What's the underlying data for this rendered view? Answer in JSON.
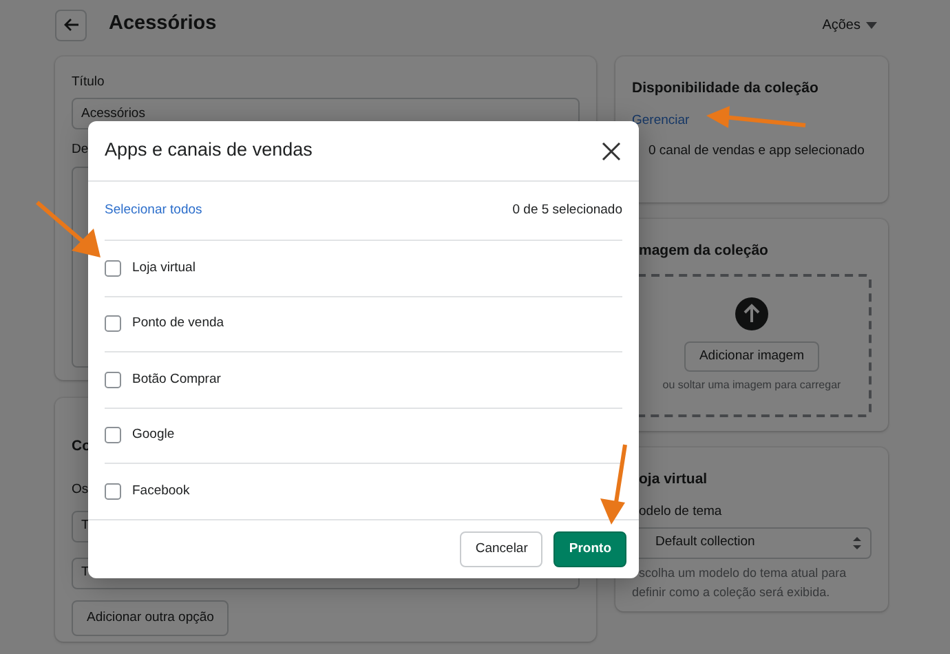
{
  "header": {
    "title": "Acessórios",
    "actions": "Ações"
  },
  "details_card": {
    "title_label": "Título",
    "title_value": "Acessórios",
    "description_label": "De"
  },
  "options_card": {
    "title": "Co",
    "label": "Os",
    "fields": [
      "T",
      "T"
    ],
    "add_button": "Adicionar outra opção"
  },
  "availability_card": {
    "title": "Disponibilidade da coleção",
    "manage_link": "Gerenciar",
    "summary": "0 canal de vendas e app selecionado"
  },
  "image_card": {
    "title": "magem da coleção",
    "button": "Adicionar imagem",
    "hint": "ou soltar uma imagem para carregar"
  },
  "store_card": {
    "title": "oja virtual",
    "template_label": "odelo de tema",
    "template_value": "Default collection",
    "help_lines": [
      "scolha um modelo do tema atual para",
      "definir como a coleção será exibida."
    ]
  },
  "modal": {
    "title": "Apps e canais de vendas",
    "select_all": "Selecionar todos",
    "count": "0 de 5 selecionado",
    "channels": [
      {
        "label": "Loja virtual",
        "checked": false
      },
      {
        "label": "Ponto de venda",
        "checked": false
      },
      {
        "label": "Botão Comprar",
        "checked": false
      },
      {
        "label": "Google",
        "checked": false
      },
      {
        "label": "Facebook",
        "checked": false
      }
    ],
    "buttons": [
      {
        "label": "Cancelar",
        "kind": "secondary"
      },
      {
        "label": "Pronto",
        "kind": "primary"
      }
    ]
  }
}
